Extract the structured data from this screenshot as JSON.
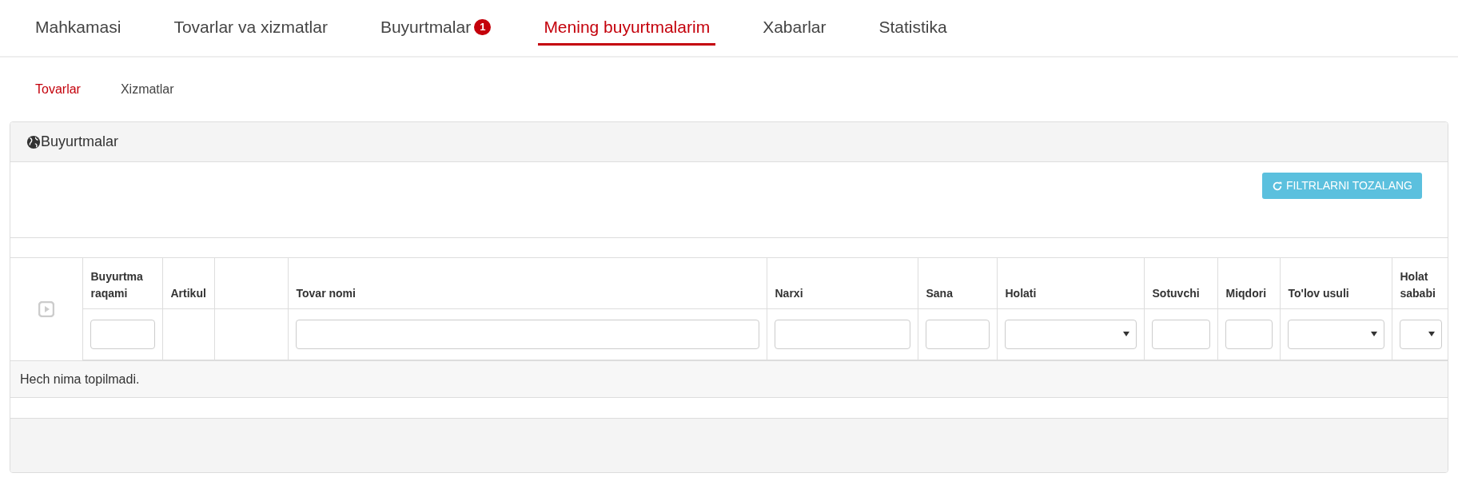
{
  "nav": [
    {
      "label": "Mahkamasi",
      "selected": false
    },
    {
      "label": "Tovarlar va xizmatlar",
      "selected": false
    },
    {
      "label": "Buyurtmalar",
      "selected": false,
      "badge": "1"
    },
    {
      "label": "Mening buyurtmalarim",
      "selected": true
    },
    {
      "label": "Xabarlar",
      "selected": false
    },
    {
      "label": "Statistika",
      "selected": false
    }
  ],
  "subtabs": [
    {
      "label": "Tovarlar",
      "selected": true
    },
    {
      "label": "Xizmatlar",
      "selected": false
    }
  ],
  "panel": {
    "title": "Buyurtmalar",
    "reset_button": "FILTRLARNI TOZALANG",
    "columns": [
      {
        "kind": "expand"
      },
      {
        "label": "Buyurtma raqami",
        "kind": "text"
      },
      {
        "label": "Artikul",
        "kind": "none"
      },
      {
        "kind": "none"
      },
      {
        "label": "Tovar nomi",
        "kind": "text"
      },
      {
        "label": "Narxi",
        "kind": "text"
      },
      {
        "label": "Sana",
        "kind": "text"
      },
      {
        "label": "Holati",
        "kind": "select"
      },
      {
        "label": "Sotuvchi",
        "kind": "text"
      },
      {
        "label": "Miqdori",
        "kind": "text"
      },
      {
        "label": "To'lov usuli",
        "kind": "select"
      },
      {
        "label": "Holat sababi",
        "kind": "select"
      }
    ],
    "empty_message": "Hech nima topilmadi."
  }
}
